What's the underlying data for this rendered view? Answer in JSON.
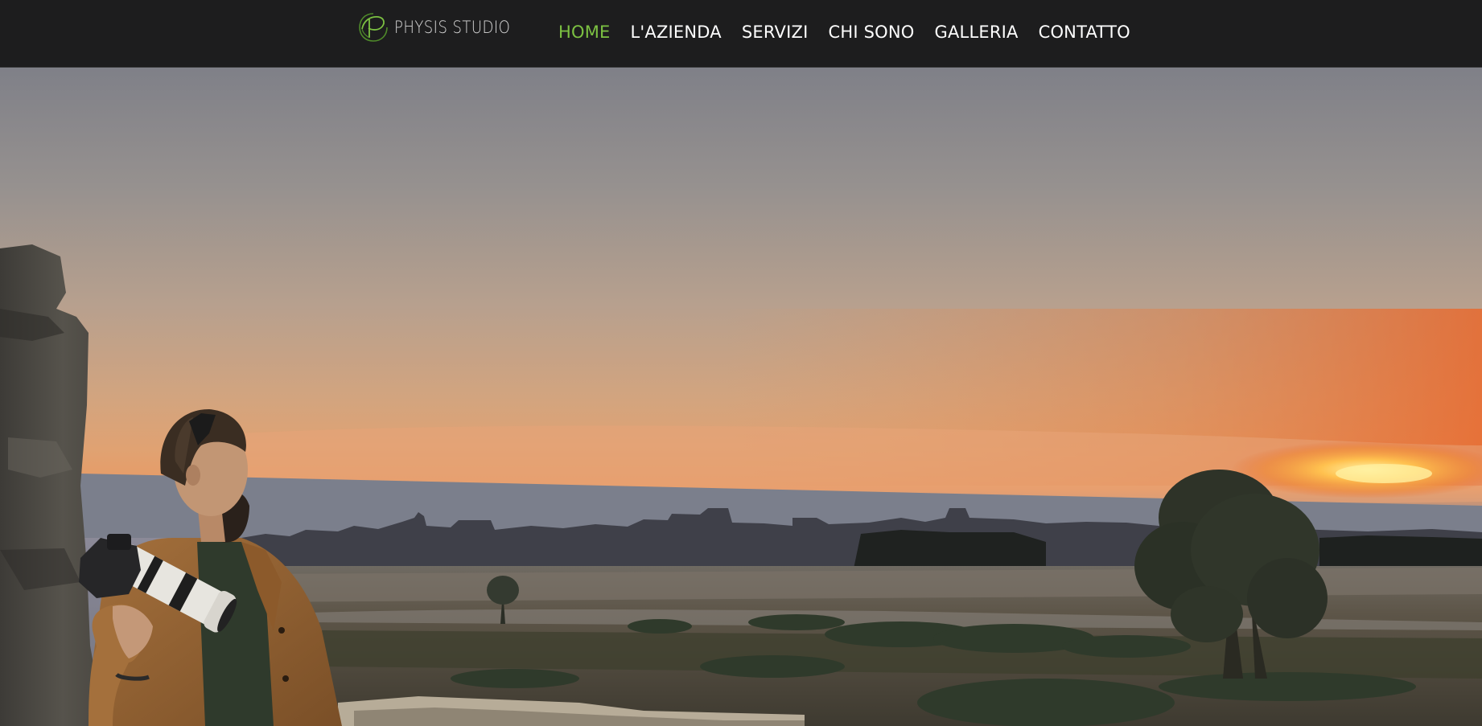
{
  "brand": {
    "name": "PHYSIS STUDIO",
    "logo_icon": "p-leaf-logo-icon",
    "accent_color": "#7cc142"
  },
  "nav": {
    "active_index": 0,
    "items": [
      {
        "label": "HOME"
      },
      {
        "label": "L'AZIENDA"
      },
      {
        "label": "SERVIZI"
      },
      {
        "label": "CHI SONO"
      },
      {
        "label": "GALLERIA"
      },
      {
        "label": "CONTATTO"
      }
    ]
  },
  "hero": {
    "image": "sunset-landscape-photographer-photo"
  }
}
